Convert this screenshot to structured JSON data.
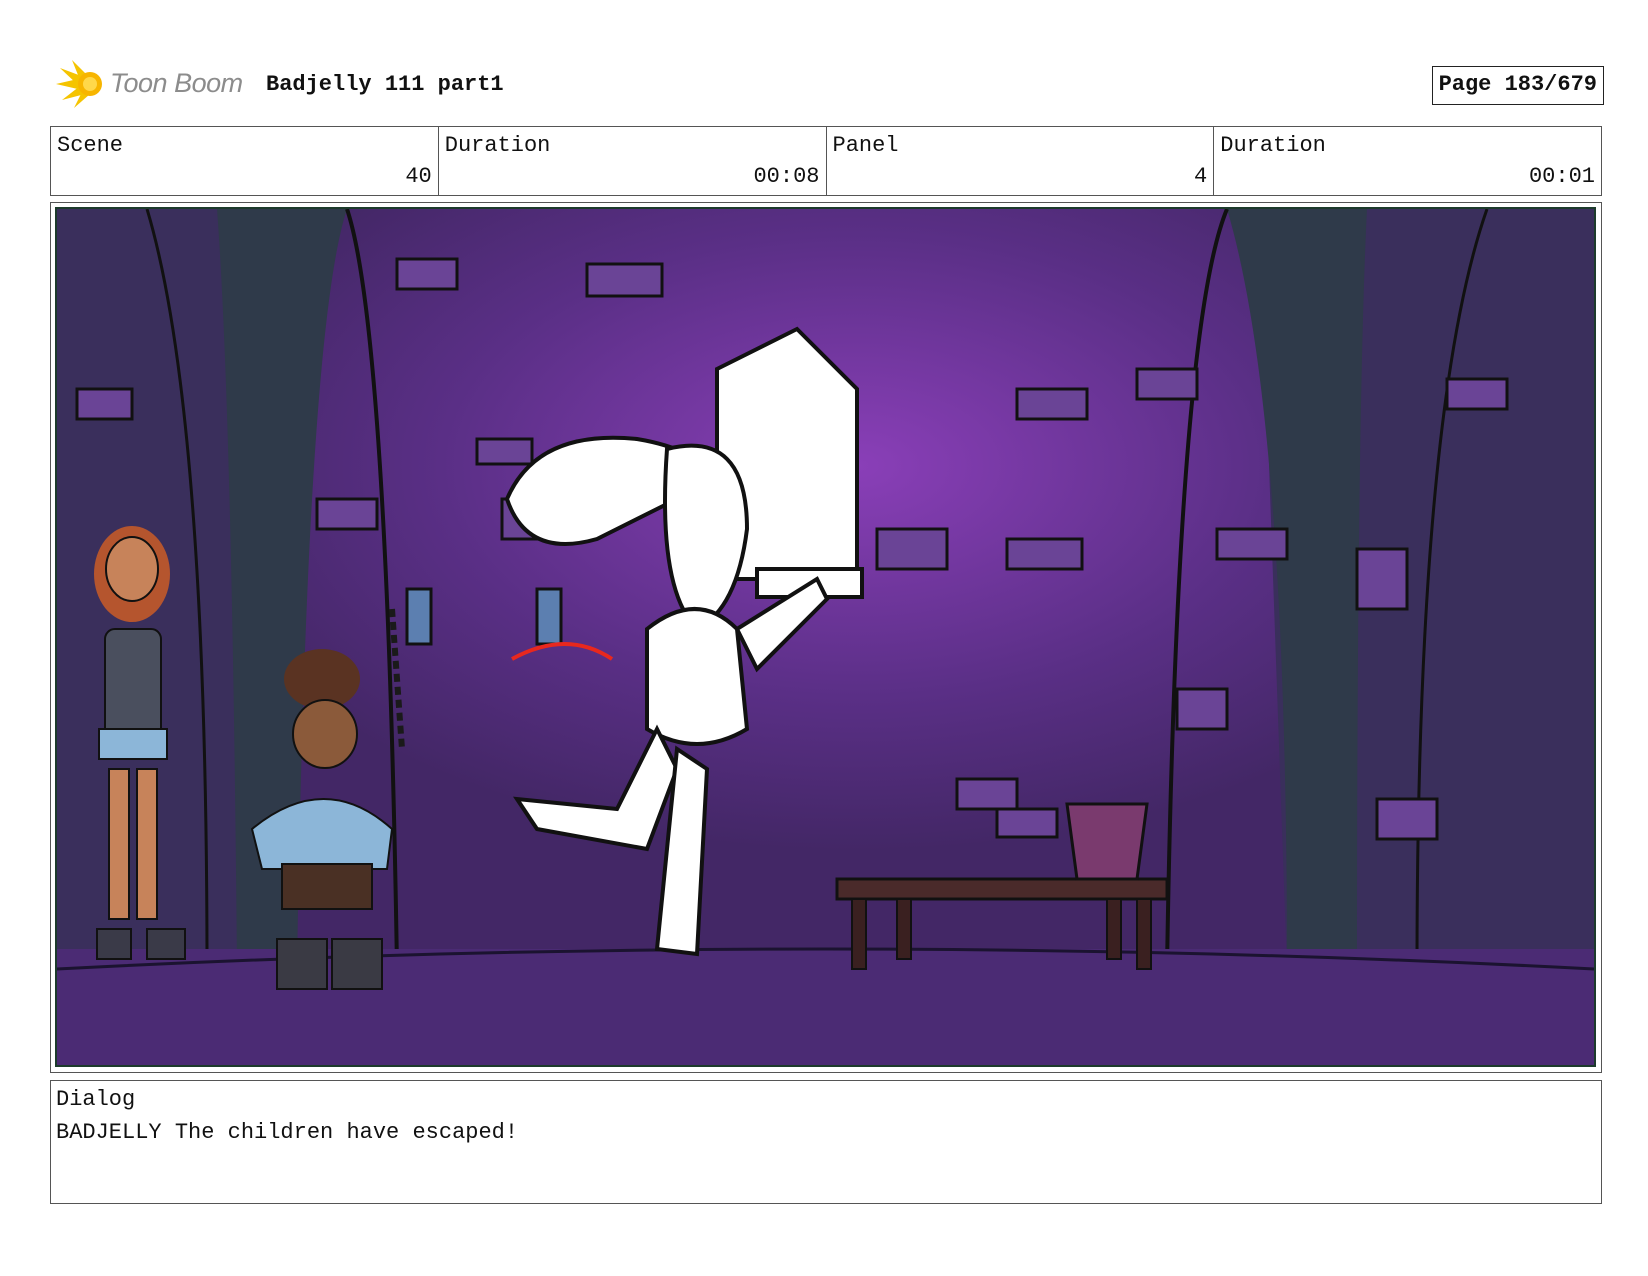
{
  "header": {
    "logo_text": "Toon Boom",
    "project_title": "Badjelly 111 part1",
    "page_label": "Page 183/679"
  },
  "info": {
    "scene_label": "Scene",
    "scene_value": "40",
    "scene_duration_label": "Duration",
    "scene_duration_value": "00:08",
    "panel_label": "Panel",
    "panel_value": "4",
    "panel_duration_label": "Duration",
    "panel_duration_value": "00:01"
  },
  "dialog": {
    "label": "Dialog",
    "text": "BADJELLY The children have escaped!"
  },
  "colors": {
    "background_purple": "#4a2a72",
    "glow_purple": "#8a3fb8",
    "pillar_teal": "#2f3a4a",
    "logo_yellow": "#f5c400",
    "accent_red": "#e8281e"
  }
}
